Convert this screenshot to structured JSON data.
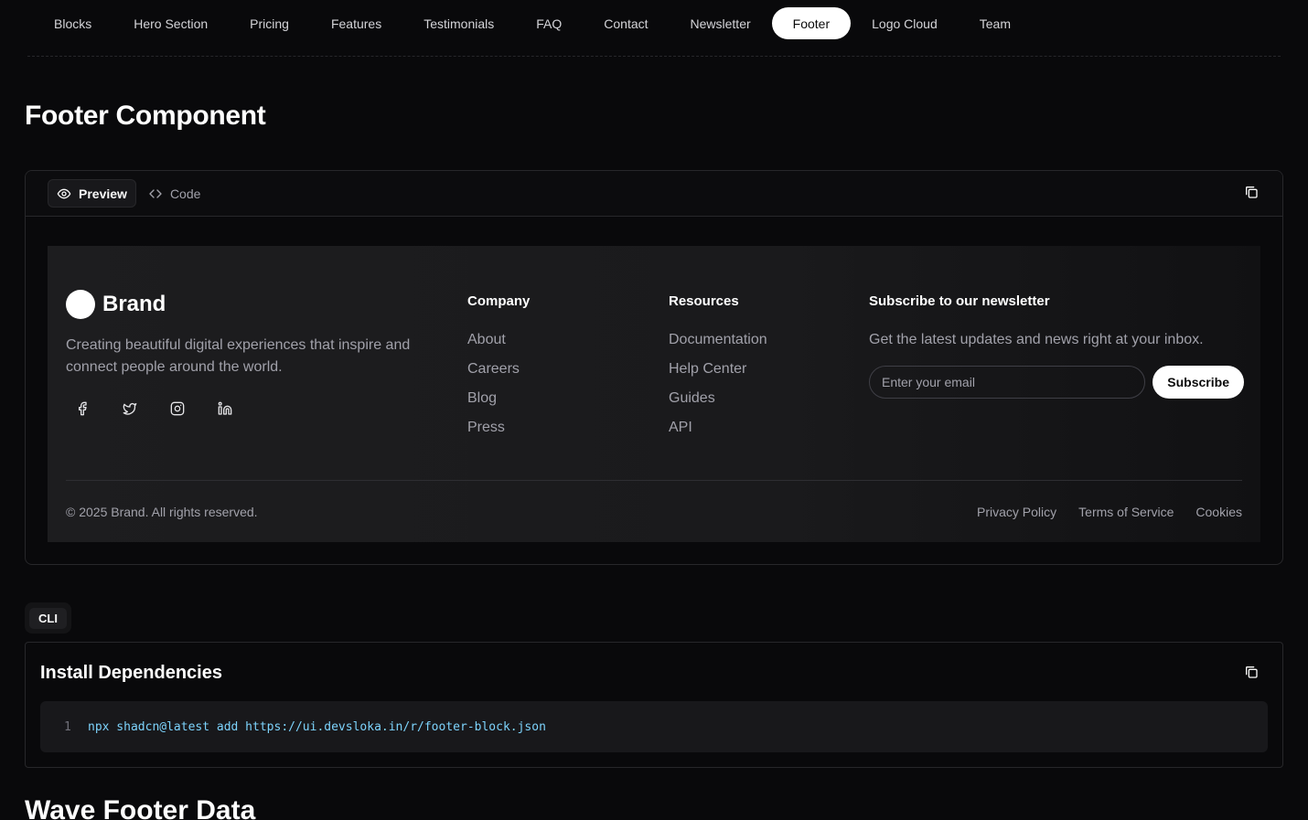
{
  "nav": {
    "tabs": [
      {
        "label": "Blocks"
      },
      {
        "label": "Hero Section"
      },
      {
        "label": "Pricing"
      },
      {
        "label": "Features"
      },
      {
        "label": "Testimonials"
      },
      {
        "label": "FAQ"
      },
      {
        "label": "Contact"
      },
      {
        "label": "Newsletter"
      },
      {
        "label": "Footer",
        "active": true
      },
      {
        "label": "Logo Cloud"
      },
      {
        "label": "Team"
      }
    ]
  },
  "page": {
    "title": "Footer Component"
  },
  "preview": {
    "preview_label": "Preview",
    "code_label": "Code"
  },
  "demo": {
    "brand_name": "Brand",
    "tagline": "Creating beautiful digital experiences that inspire and connect people around the world.",
    "socials": [
      "facebook-icon",
      "twitter-icon",
      "instagram-icon",
      "linkedin-icon"
    ],
    "company": {
      "heading": "Company",
      "links": [
        "About",
        "Careers",
        "Blog",
        "Press"
      ]
    },
    "resources": {
      "heading": "Resources",
      "links": [
        "Documentation",
        "Help Center",
        "Guides",
        "API"
      ]
    },
    "newsletter": {
      "heading": "Subscribe to our newsletter",
      "description": "Get the latest updates and news right at your inbox.",
      "email_placeholder": "Enter your email",
      "email_value": "",
      "subscribe_label": "Subscribe"
    },
    "copyright": "© 2025 Brand. All rights reserved.",
    "legal": [
      "Privacy Policy",
      "Terms of Service",
      "Cookies"
    ]
  },
  "cli": {
    "tab_label": "CLI",
    "title": "Install Dependencies",
    "line_number": "1",
    "command": "npx shadcn@latest add https://ui.devsloka.in/r/footer-block.json"
  },
  "next_section": {
    "title": "Wave Footer Data"
  },
  "colors": {
    "background": "#09090b",
    "active_tab_bg": "#ffffff",
    "code_text": "#7dd3fc",
    "muted_text": "#a1a1aa"
  }
}
